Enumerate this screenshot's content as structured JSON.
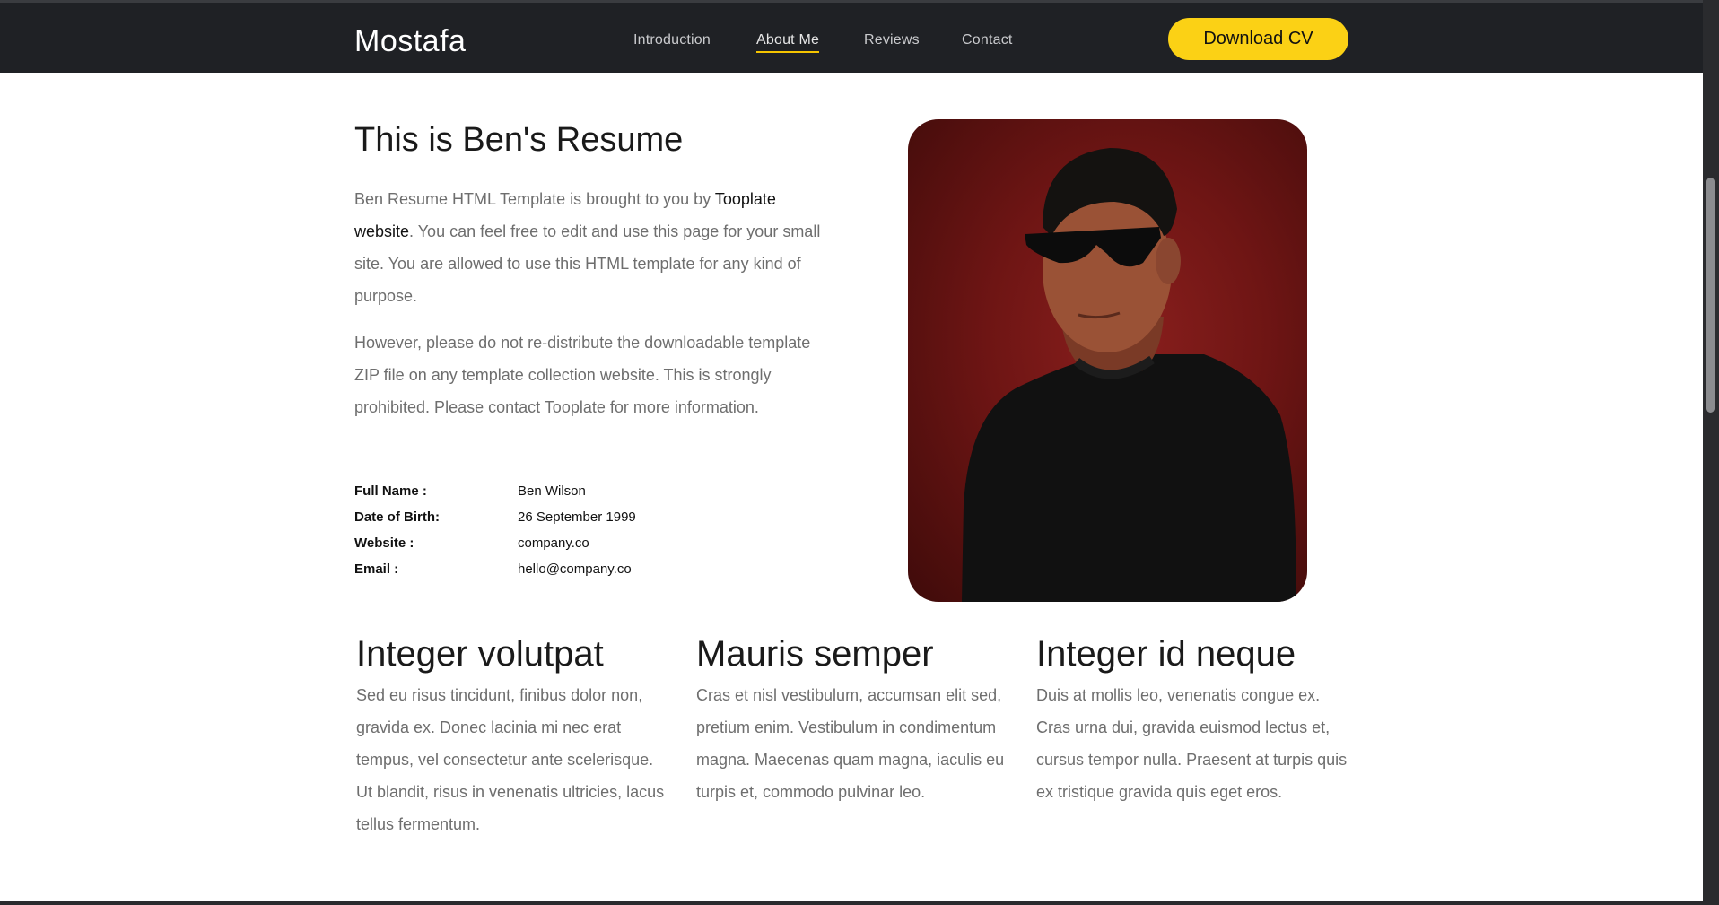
{
  "nav": {
    "brand": "Mostafa",
    "links": [
      "Introduction",
      "About Me",
      "Reviews",
      "Contact"
    ],
    "active": "About Me",
    "cta": "Download CV",
    "accent": "#fbd115"
  },
  "resume": {
    "title": "This is Ben's Resume",
    "para1_before": "Ben Resume HTML Template is brought to you by ",
    "para1_link": "Tooplate website",
    "para1_after": ". You can feel free to edit and use this page for your small site. You are allowed to use this HTML template for any kind of purpose.",
    "para2": "However, please do not re-distribute the downloadable template ZIP file on any template collection website. This is strongly prohibited. Please contact Tooplate for more information.",
    "info": [
      {
        "label": "Full Name :",
        "value": "Ben Wilson"
      },
      {
        "label": "Date of Birth:",
        "value": "26 September 1999"
      },
      {
        "label": "Website :",
        "value": "company.co"
      },
      {
        "label": "Email :",
        "value": "hello@company.co"
      }
    ]
  },
  "columns": [
    {
      "title": "Integer volutpat",
      "text": "Sed eu risus tincidunt, finibus dolor non, gravida ex. Donec lacinia mi nec erat tempus, vel consectetur ante scelerisque. Ut blandit, risus in venenatis ultricies, lacus tellus fermentum."
    },
    {
      "title": "Mauris semper",
      "text": "Cras et nisl vestibulum, accumsan elit sed, pretium enim. Vestibulum in condimentum magna. Maecenas quam magna, iaculis eu turpis et, commodo pulvinar leo."
    },
    {
      "title": "Integer id neque",
      "text": "Duis at mollis leo, venenatis congue ex. Cras urna dui, gravida euismod lectus et, cursus tempor nulla. Praesent at turpis quis ex tristique gravida quis eget eros."
    }
  ]
}
